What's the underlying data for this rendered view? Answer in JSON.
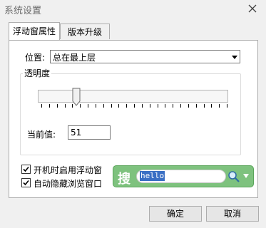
{
  "window": {
    "title": "系统设置"
  },
  "tabs": [
    {
      "label": "浮动窗属性",
      "active": true
    },
    {
      "label": "版本升级",
      "active": false
    }
  ],
  "position": {
    "label": "位置:",
    "selected": "总在最上层"
  },
  "transparency": {
    "group_title": "透明度",
    "slider_value": 51,
    "slider_max": 255,
    "tick_count": 25
  },
  "current_value": {
    "label": "当前值:",
    "value": "51"
  },
  "options": [
    {
      "label": "开机时启用浮动窗",
      "checked": true
    },
    {
      "label": "自动隐藏浏览窗口",
      "checked": true
    }
  ],
  "searchbar": {
    "icon_char": "搜",
    "input_text": "hello"
  },
  "buttons": {
    "ok": "确定",
    "cancel": "取消"
  },
  "colors": {
    "search_bar": "#7ec27e",
    "selection": "#3a6fc4"
  }
}
